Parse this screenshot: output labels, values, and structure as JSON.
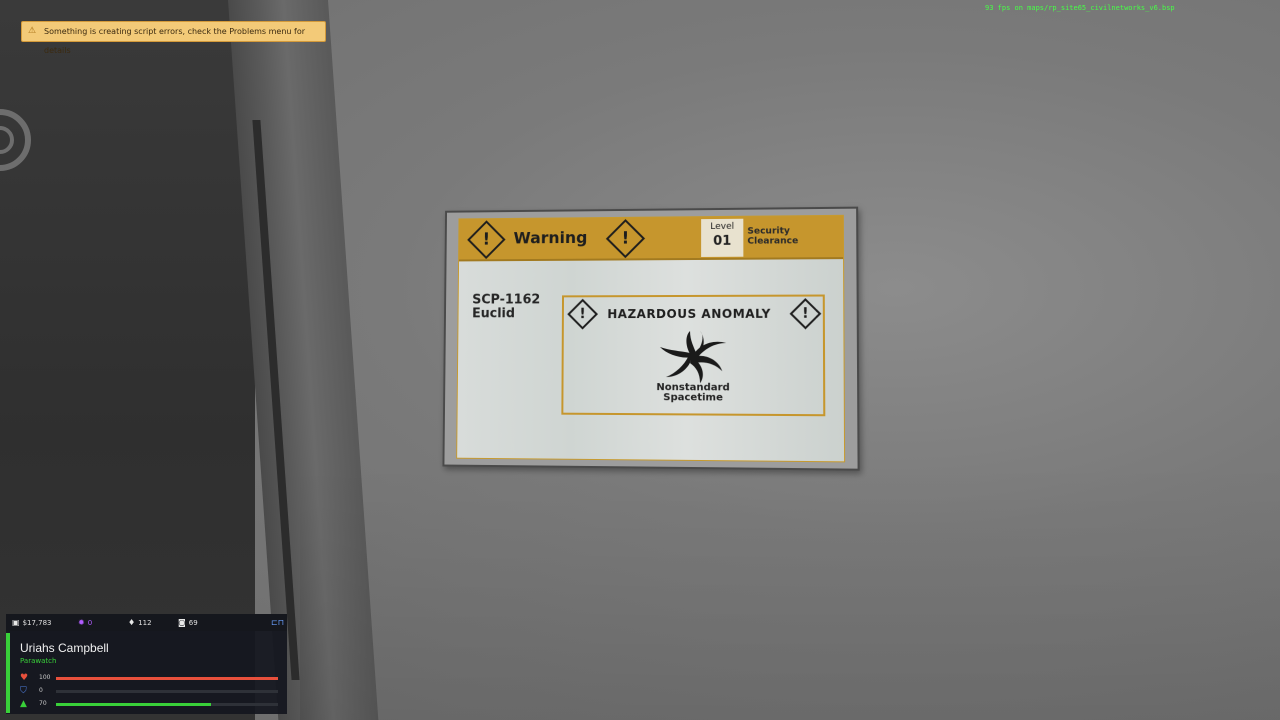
{
  "notification": {
    "text": "Something is creating script errors, check the Problems menu for details",
    "icon": "warning-icon"
  },
  "fps_readout": "93 fps on maps/rp_site65_civilnetworks_v6.bsp",
  "poster": {
    "header_title": "Warning",
    "level_label": "Level",
    "level_value": "01",
    "clearance_label": "Security Clearance",
    "scp_number": "SCP-1162",
    "object_class": "Euclid",
    "hazard_title": "HAZARDOUS ANOMALY",
    "hazard_caption_line1": "Nonstandard",
    "hazard_caption_line2": "Spacetime",
    "accent_color": "#c6962d"
  },
  "hud": {
    "money": "$17,783",
    "purple_count": "0",
    "diamond_count": "112",
    "camera_count": "69",
    "player_name": "Uriahs Campbell",
    "team": "Parawatch",
    "health": {
      "value": "100",
      "fraction": 1.0,
      "color": "#e8503c"
    },
    "armor": {
      "value": "0",
      "fraction": 0.0,
      "color": "#4f7fe0"
    },
    "stamina": {
      "value": "70",
      "fraction": 0.7,
      "color": "#39d039"
    },
    "accent_color": "#39d039"
  }
}
